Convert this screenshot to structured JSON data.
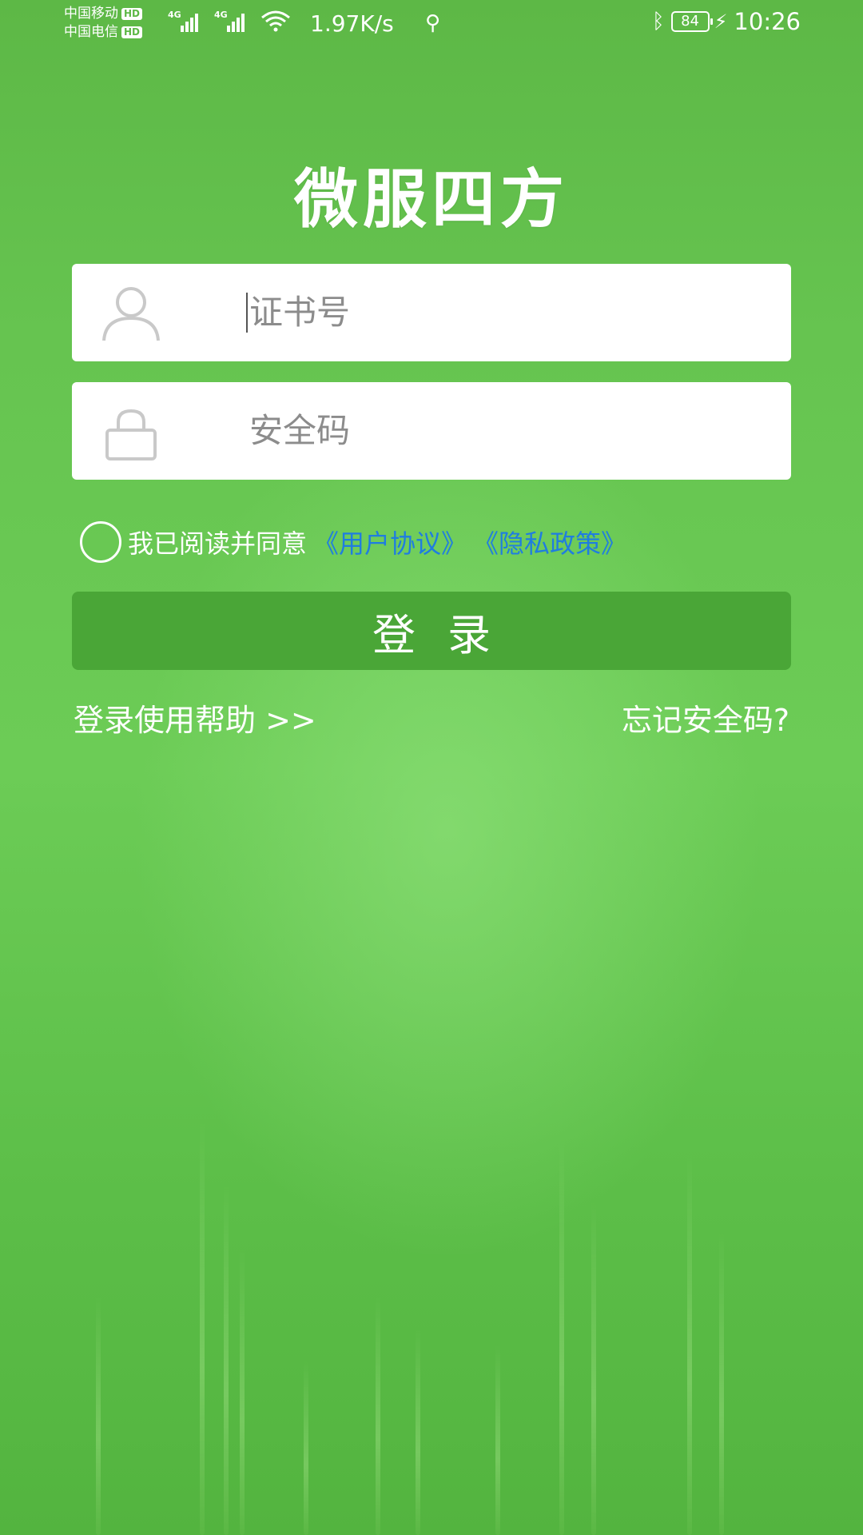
{
  "status_bar": {
    "carrier_1": "中国移动",
    "carrier_2": "中国电信",
    "hd_badge": "HD",
    "network_type_1": "4G",
    "network_type_2": "4G",
    "net_speed": "1.97K/s",
    "battery_level": "84",
    "time": "10:26"
  },
  "app": {
    "title": "微服四方"
  },
  "login_form": {
    "cert_number_placeholder": "证书号",
    "security_code_placeholder": "安全码",
    "agreement_text": "我已阅读并同意",
    "user_agreement_link": "《用户协议》",
    "privacy_policy_link": "《隐私政策》",
    "login_label": "登录",
    "help_link": "登录使用帮助 >>",
    "forgot_link": "忘记安全码?"
  },
  "colors": {
    "background": "#66c450",
    "button": "#4aa637",
    "link": "#1f7de0",
    "input_background": "#ffffff"
  },
  "icons": {
    "user_field": "user-icon",
    "code_field": "lock-icon",
    "status_wifi": "wifi-icon",
    "status_usb": "usb-icon",
    "status_bluetooth": "bluetooth-icon",
    "status_charging": "bolt-icon"
  }
}
